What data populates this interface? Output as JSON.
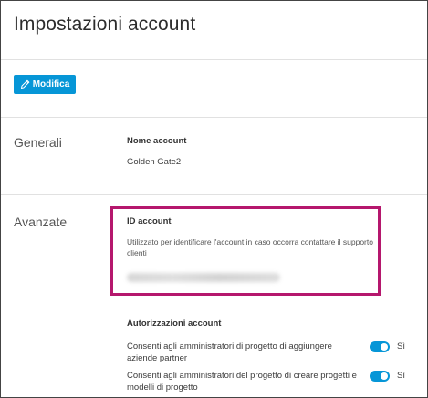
{
  "page": {
    "title": "Impostazioni account"
  },
  "toolbar": {
    "edit_label": "Modifica",
    "edit_icon": "pencil-icon"
  },
  "sections": {
    "general": {
      "label": "Generali",
      "account_name_title": "Nome account",
      "account_name_value": "Golden Gate2"
    },
    "advanced": {
      "label": "Avanzate",
      "account_id_title": "ID account",
      "account_id_desc": "Utilizzato per identificare l'account in caso occorra contattare il supporto clienti",
      "permissions_title": "Autorizzazioni account",
      "permissions": [
        {
          "text": "Consenti agli amministratori di progetto di aggiungere aziende partner",
          "toggle_label": "Sì",
          "enabled": true
        },
        {
          "text": "Consenti agli amministratori del progetto di creare progetti e modelli di progetto",
          "toggle_label": "Sì",
          "enabled": true
        }
      ]
    }
  },
  "colors": {
    "accent": "#0696d7",
    "highlight": "#b5176d"
  }
}
